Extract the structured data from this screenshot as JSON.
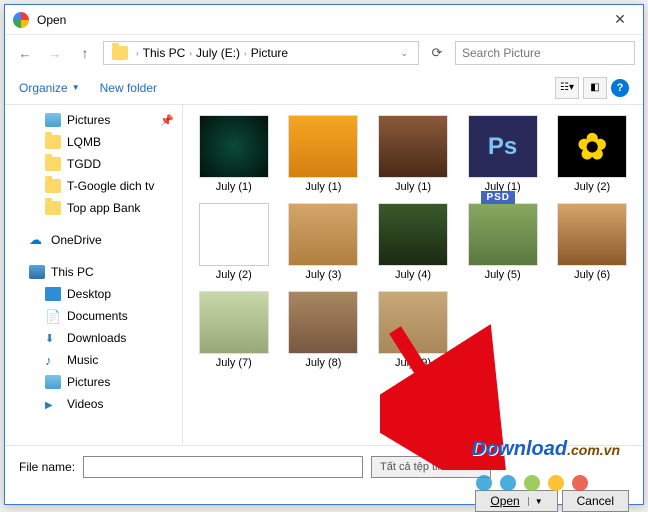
{
  "window": {
    "title": "Open"
  },
  "nav": {
    "breadcrumb": [
      "This PC",
      "July (E:)",
      "Picture"
    ],
    "search_placeholder": "Search Picture"
  },
  "toolbar": {
    "organize": "Organize",
    "new_folder": "New folder"
  },
  "sidebar": [
    {
      "label": "Pictures",
      "icon": "pictures",
      "level": 2,
      "pinned": true
    },
    {
      "label": "LQMB",
      "icon": "folder",
      "level": 2
    },
    {
      "label": "TGDD",
      "icon": "folder",
      "level": 2
    },
    {
      "label": "T-Google dich tv",
      "icon": "folder",
      "level": 2
    },
    {
      "label": "Top app Bank",
      "icon": "folder",
      "level": 2
    },
    {
      "label": "OneDrive",
      "icon": "onedrive",
      "level": 1,
      "spaced": true
    },
    {
      "label": "This PC",
      "icon": "thispc",
      "level": 1,
      "spaced": true
    },
    {
      "label": "Desktop",
      "icon": "desktop",
      "level": 2
    },
    {
      "label": "Documents",
      "icon": "doc",
      "level": 2
    },
    {
      "label": "Downloads",
      "icon": "down",
      "level": 2
    },
    {
      "label": "Music",
      "icon": "music",
      "level": 2
    },
    {
      "label": "Pictures",
      "icon": "pictures",
      "level": 2
    },
    {
      "label": "Videos",
      "icon": "vid",
      "level": 2
    }
  ],
  "files": [
    {
      "label": "July (1)",
      "thumb": "t0"
    },
    {
      "label": "July (1)",
      "thumb": "t1"
    },
    {
      "label": "July (1)",
      "thumb": "t2"
    },
    {
      "label": "July (1)",
      "thumb": "t3 ps"
    },
    {
      "label": "July (2)",
      "thumb": "t4 sunflower"
    },
    {
      "label": "July (2)",
      "thumb": "t5"
    },
    {
      "label": "July (3)",
      "thumb": "t6"
    },
    {
      "label": "July (4)",
      "thumb": "t7"
    },
    {
      "label": "July (5)",
      "thumb": "t8"
    },
    {
      "label": "July (6)",
      "thumb": "t9"
    },
    {
      "label": "July (7)",
      "thumb": "t10"
    },
    {
      "label": "July (8)",
      "thumb": "t11"
    },
    {
      "label": "July (9)",
      "thumb": "t12"
    }
  ],
  "bottom": {
    "filename_label": "File name:",
    "filename_value": "",
    "filter": "Tất cả tệp tin",
    "open": "Open",
    "cancel": "Cancel"
  },
  "annotations": {
    "psd_tag": "PSD"
  },
  "watermark_main": "Download",
  "watermark_ext": ".com.vn"
}
